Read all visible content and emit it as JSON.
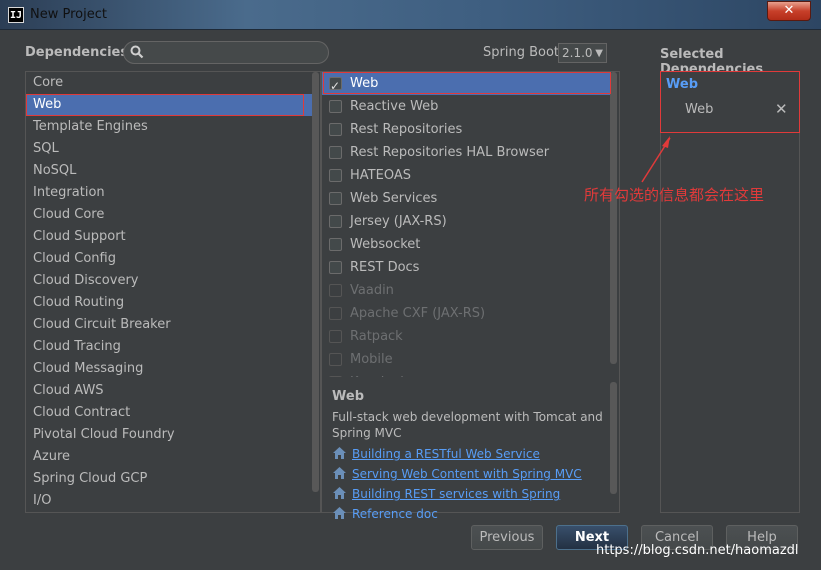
{
  "window": {
    "title": "New Project",
    "app_icon_text": "IJ",
    "close_glyph": "✕"
  },
  "dependencies_label": "Dependencies",
  "search": {
    "value": "",
    "placeholder": ""
  },
  "spring_boot": {
    "label": "Spring Boot",
    "version": "2.1.0"
  },
  "categories": [
    "Core",
    "Web",
    "Template Engines",
    "SQL",
    "NoSQL",
    "Integration",
    "Cloud Core",
    "Cloud Support",
    "Cloud Config",
    "Cloud Discovery",
    "Cloud Routing",
    "Cloud Circuit Breaker",
    "Cloud Tracing",
    "Cloud Messaging",
    "Cloud AWS",
    "Cloud Contract",
    "Pivotal Cloud Foundry",
    "Azure",
    "Spring Cloud GCP",
    "I/O"
  ],
  "dependencies": [
    {
      "label": "Web",
      "checked": true,
      "enabled": true
    },
    {
      "label": "Reactive Web",
      "checked": false,
      "enabled": true
    },
    {
      "label": "Rest Repositories",
      "checked": false,
      "enabled": true
    },
    {
      "label": "Rest Repositories HAL Browser",
      "checked": false,
      "enabled": true
    },
    {
      "label": "HATEOAS",
      "checked": false,
      "enabled": true
    },
    {
      "label": "Web Services",
      "checked": false,
      "enabled": true
    },
    {
      "label": "Jersey (JAX-RS)",
      "checked": false,
      "enabled": true
    },
    {
      "label": "Websocket",
      "checked": false,
      "enabled": true
    },
    {
      "label": "REST Docs",
      "checked": false,
      "enabled": true
    },
    {
      "label": "Vaadin",
      "checked": false,
      "enabled": false
    },
    {
      "label": "Apache CXF (JAX-RS)",
      "checked": false,
      "enabled": false
    },
    {
      "label": "Ratpack",
      "checked": false,
      "enabled": false
    },
    {
      "label": "Mobile",
      "checked": false,
      "enabled": false
    },
    {
      "label": "Keycloak",
      "checked": false,
      "enabled": false
    }
  ],
  "description": {
    "title": "Web",
    "text": "Full-stack web development with Tomcat and Spring MVC",
    "links": [
      "Building a RESTful Web Service",
      "Serving Web Content with Spring MVC",
      "Building REST services with Spring",
      "Reference doc"
    ]
  },
  "selected": {
    "title": "Selected Dependencies",
    "group": "Web",
    "items": [
      "Web"
    ],
    "remove_glyph": "✕"
  },
  "annotation": "所有勾选的信息都会在这里",
  "buttons": {
    "previous": "Previous",
    "next": "Next",
    "cancel": "Cancel",
    "help": "Help"
  },
  "watermark": "https://blog.csdn.net/haomazdl",
  "colors": {
    "selection": "#4b6eaf",
    "annotation": "#e03a3a",
    "link": "#589df6"
  }
}
